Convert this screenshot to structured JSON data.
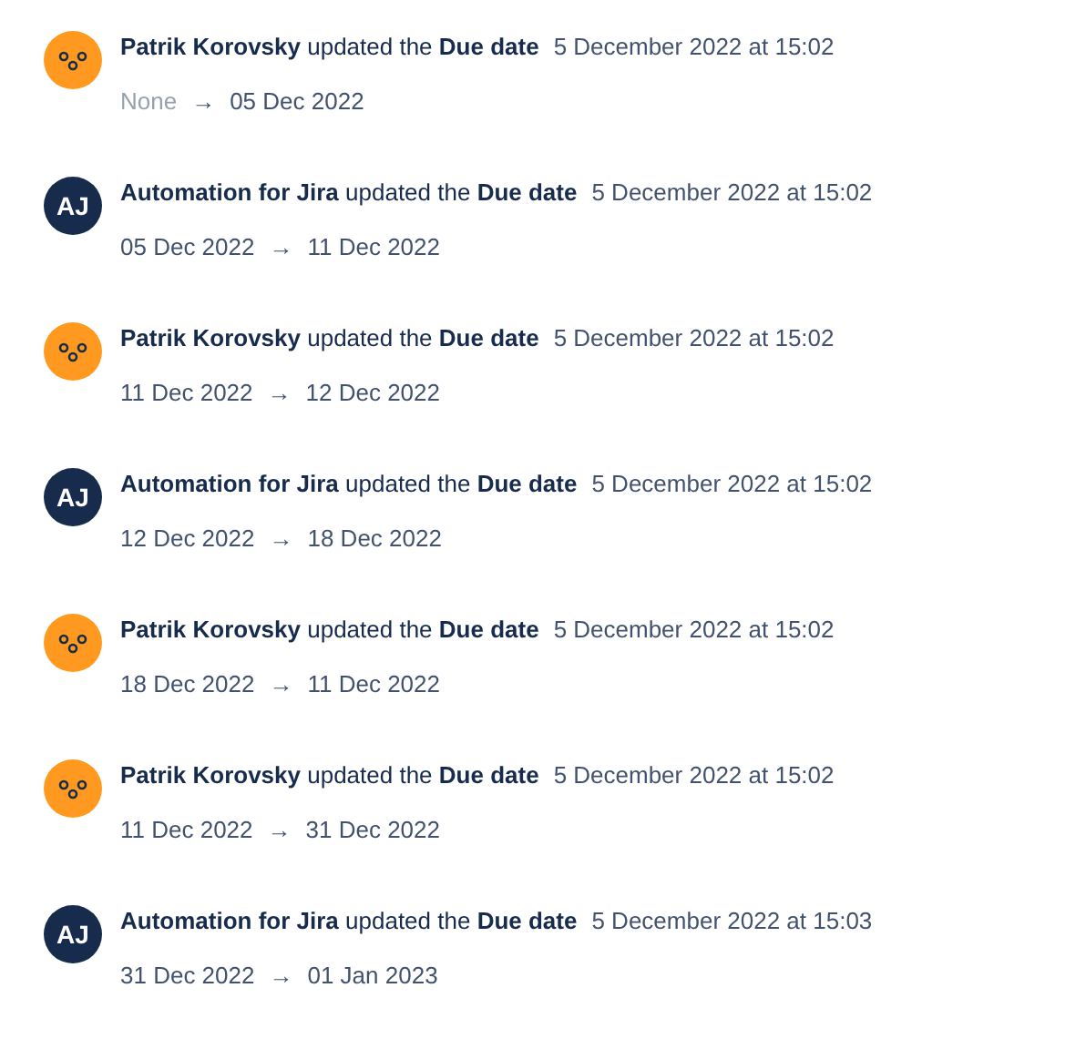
{
  "history": [
    {
      "avatar": {
        "kind": "face"
      },
      "summary": "**Patrik Korovsky** updated the **Due date**",
      "time": "5 December 2022 at 15:02",
      "from": "None",
      "from_greyed": true,
      "arrow": "→",
      "to": "05 Dec 2022"
    },
    {
      "avatar": {
        "kind": "initials",
        "text": "AJ"
      },
      "summary": "**Automation for Jira** updated the **Due date**",
      "time": "5 December 2022 at 15:02",
      "from": "05 Dec 2022",
      "from_greyed": false,
      "arrow": "→",
      "to": "11 Dec 2022"
    },
    {
      "avatar": {
        "kind": "face"
      },
      "summary": "**Patrik Korovsky** updated the **Due date**",
      "time": "5 December 2022 at 15:02",
      "from": "11 Dec 2022",
      "from_greyed": false,
      "arrow": "→",
      "to": "12 Dec 2022"
    },
    {
      "avatar": {
        "kind": "initials",
        "text": "AJ"
      },
      "summary": "**Automation for Jira** updated the **Due date**",
      "time": "5 December 2022 at 15:02",
      "from": "12 Dec 2022",
      "from_greyed": false,
      "arrow": "→",
      "to": "18 Dec 2022"
    },
    {
      "avatar": {
        "kind": "face"
      },
      "summary": "**Patrik Korovsky** updated the **Due date**",
      "time": "5 December 2022 at 15:02",
      "from": "18 Dec 2022",
      "from_greyed": false,
      "arrow": "→",
      "to": "11 Dec 2022"
    },
    {
      "avatar": {
        "kind": "face"
      },
      "summary": "**Patrik Korovsky** updated the **Due date**",
      "time": "5 December 2022 at 15:02",
      "from": "11 Dec 2022",
      "from_greyed": false,
      "arrow": "→",
      "to": "31 Dec 2022"
    },
    {
      "avatar": {
        "kind": "initials",
        "text": "AJ"
      },
      "summary": "**Automation for Jira** updated the **Due date**",
      "time": "5 December 2022 at 15:03",
      "from": "31 Dec 2022",
      "from_greyed": false,
      "arrow": "→",
      "to": "01 Jan 2023"
    }
  ]
}
